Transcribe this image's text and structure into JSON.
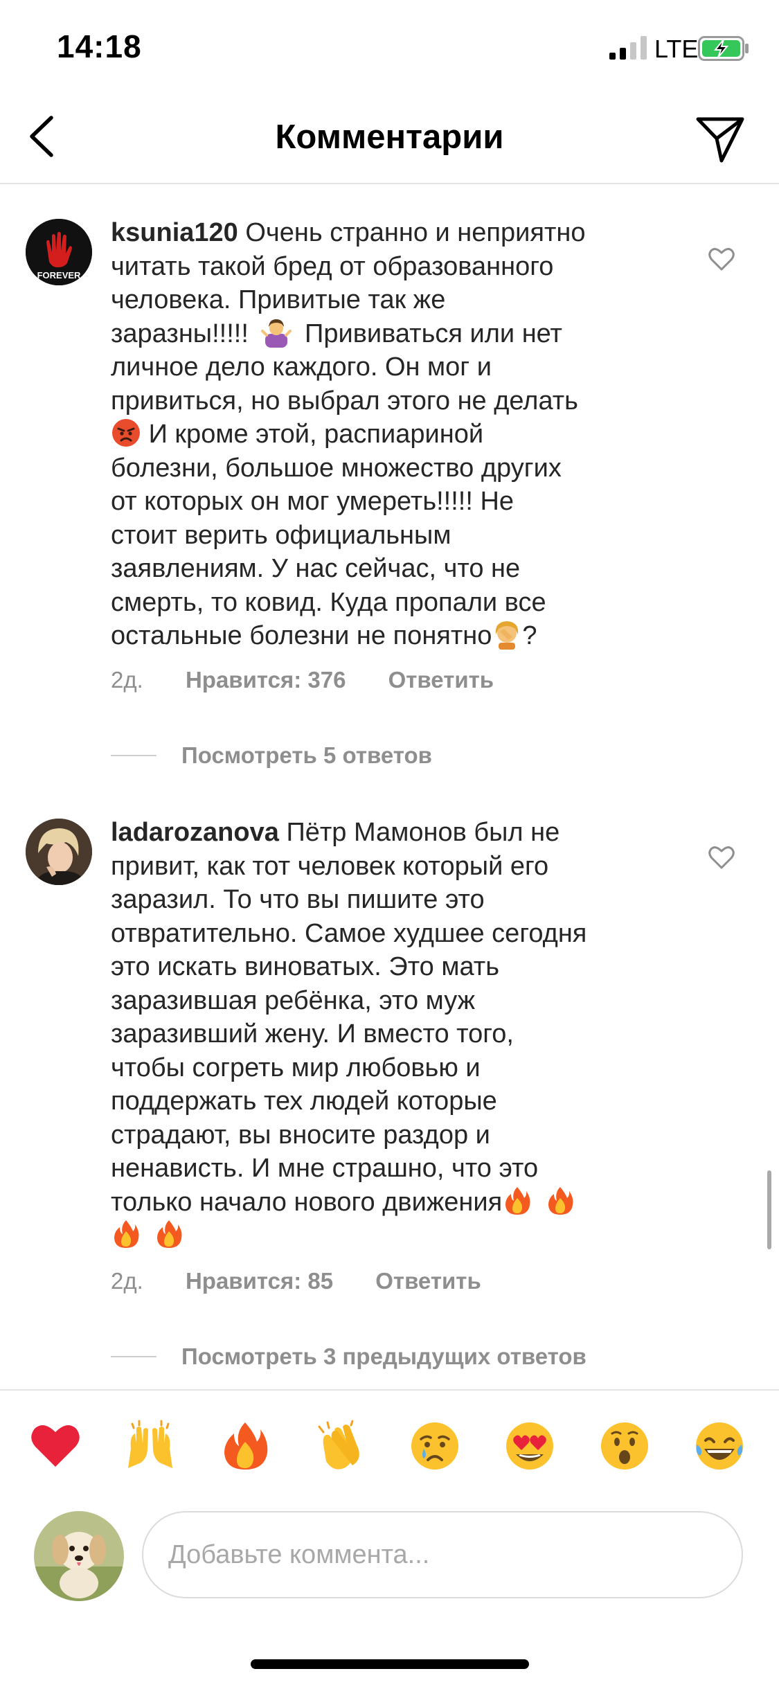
{
  "status_bar": {
    "time": "14:18",
    "network": "LTE"
  },
  "header": {
    "title": "Комментарии"
  },
  "comments": [
    {
      "username": "ksunia120",
      "lines": [
        "Очень странно и неприятно",
        "читать такой бред от образованного",
        "человека. Привитые так же",
        "заразны!!!!!",
        "Прививаться или нет",
        "личное дело каждого. Он мог и",
        "привиться, но выбрал этого не делать",
        "И кроме этой, распиариной",
        "болезни, большое множество других",
        "от которых он мог умереть!!!!! Не",
        "стоит верить официальным",
        "заявлениям. У нас сейчас, что не",
        "смерть, то ковид. Куда пропали все",
        "остальные болезни не понятно",
        "?"
      ],
      "time": "2д.",
      "likes": "Нравится: 376",
      "reply": "Ответить",
      "view_replies": "Посмотреть 5 ответов"
    },
    {
      "username": "ladarozanova",
      "lines": [
        "Пётр Мамонов был не",
        "привит, как тот человек который его",
        "заразил. То что вы пишите это",
        "отвратительно. Самое худшее сегодня",
        "это искать виноватых. Это мать",
        "заразившая  ребёнка, это муж",
        "заразивший жену. И вместо того,",
        "чтобы согреть мир любовью и",
        "поддержать тех людей которые",
        "страдают,  вы вносите раздор и",
        "ненависть. И мне страшно,  что это",
        "только начало нового движения"
      ],
      "time": "2д.",
      "likes": "Нравится: 85",
      "reply": "Ответить",
      "view_replies": "Посмотреть 3 предыдущих ответов"
    }
  ],
  "reactions": [
    "heart",
    "raised-hands",
    "fire",
    "clapping-hands",
    "crying-face",
    "heart-eyes",
    "surprised-face",
    "laughing-tears"
  ],
  "composer": {
    "placeholder": "Добавьте коммента..."
  }
}
